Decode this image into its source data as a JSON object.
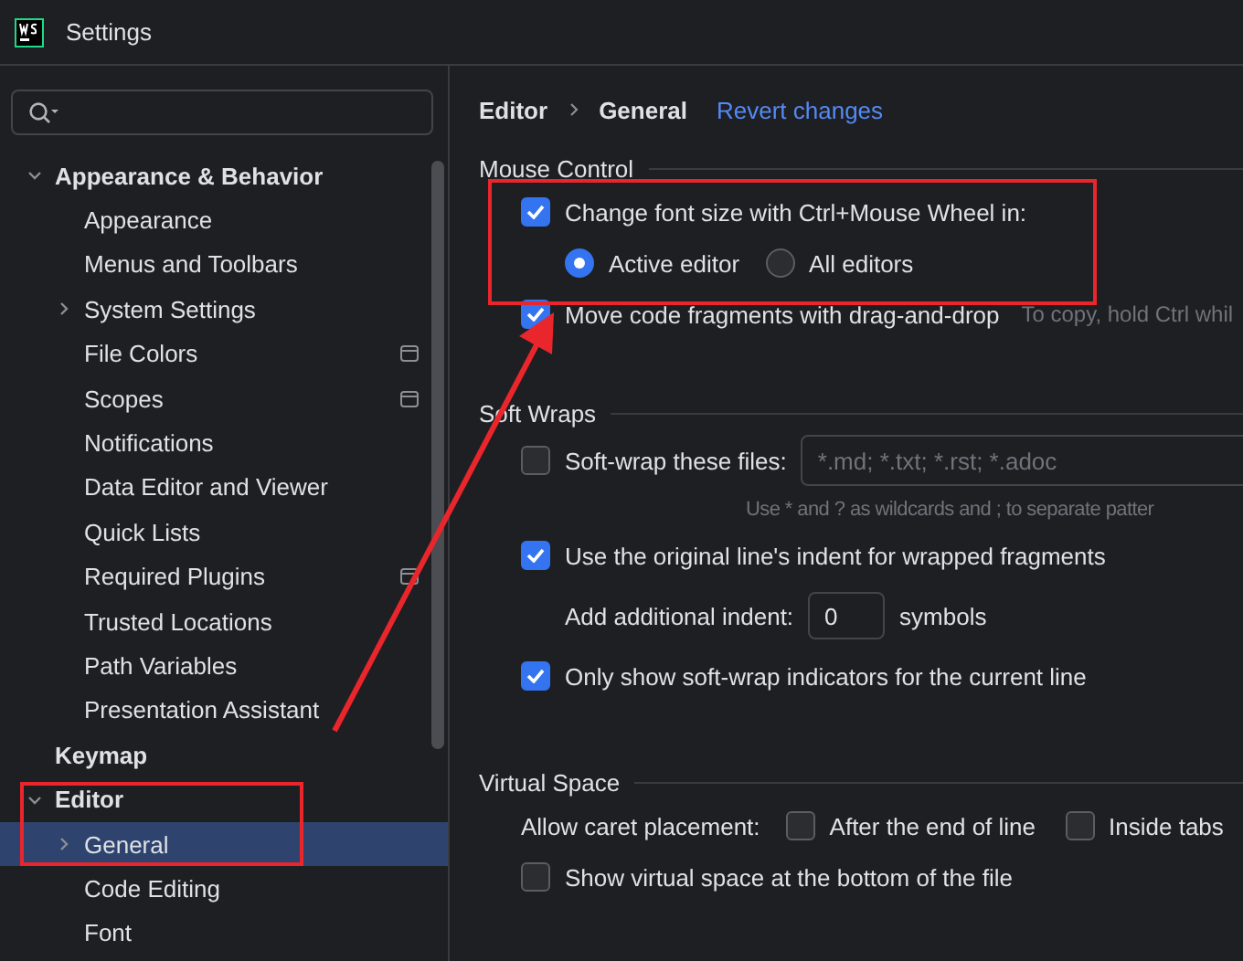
{
  "window": {
    "title": "Settings"
  },
  "sidebar": {
    "items": [
      {
        "label": "Appearance & Behavior",
        "expanded": true,
        "selected": false,
        "children": [
          {
            "label": "Appearance",
            "selected": false,
            "project_level": false
          },
          {
            "label": "Menus and Toolbars",
            "selected": false,
            "project_level": false
          },
          {
            "label": "System Settings",
            "expanded": false,
            "selected": false,
            "project_level": false
          },
          {
            "label": "File Colors",
            "selected": false,
            "project_level": true
          },
          {
            "label": "Scopes",
            "selected": false,
            "project_level": true
          },
          {
            "label": "Notifications",
            "selected": false,
            "project_level": false
          },
          {
            "label": "Data Editor and Viewer",
            "selected": false,
            "project_level": false
          },
          {
            "label": "Quick Lists",
            "selected": false,
            "project_level": false
          },
          {
            "label": "Required Plugins",
            "selected": false,
            "project_level": true
          },
          {
            "label": "Trusted Locations",
            "selected": false,
            "project_level": false
          },
          {
            "label": "Path Variables",
            "selected": false,
            "project_level": false
          },
          {
            "label": "Presentation Assistant",
            "selected": false,
            "project_level": false
          }
        ]
      },
      {
        "label": "Keymap",
        "selected": false
      },
      {
        "label": "Editor",
        "expanded": true,
        "selected": false,
        "children": [
          {
            "label": "General",
            "expanded": false,
            "selected": true,
            "project_level": false
          },
          {
            "label": "Code Editing",
            "selected": false,
            "project_level": false
          },
          {
            "label": "Font",
            "selected": false,
            "project_level": false
          }
        ]
      }
    ]
  },
  "breadcrumb": [
    "Editor",
    "General"
  ],
  "revert_link": "Revert changes",
  "sections": [
    {
      "title": "Mouse Control",
      "rows": [
        {
          "kind": "checkbox",
          "label": "Change font size with Ctrl+Mouse Wheel in:",
          "checked": true
        },
        {
          "kind": "radios",
          "options": [
            {
              "label": "Active editor",
              "selected": true
            },
            {
              "label": "All editors",
              "selected": false
            }
          ]
        },
        {
          "kind": "checkbox",
          "label": "Move code fragments with drag-and-drop",
          "checked": true,
          "hint": "To copy, hold Ctrl whil"
        }
      ]
    },
    {
      "title": "Soft Wraps",
      "rows": [
        {
          "kind": "checkbox_field",
          "label": "Soft-wrap these files:",
          "checked": false,
          "placeholder": "*.md; *.txt; *.rst; *.adoc"
        },
        {
          "kind": "note",
          "text": "Use * and ? as wildcards and ; to separate patter"
        },
        {
          "kind": "checkbox",
          "label": "Use the original line's indent for wrapped fragments",
          "checked": true
        },
        {
          "kind": "number",
          "label": "Add additional indent:",
          "value": "0",
          "unit": "symbols"
        },
        {
          "kind": "checkbox",
          "label": "Only show soft-wrap indicators for the current line",
          "checked": true
        }
      ]
    },
    {
      "title": "Virtual Space",
      "rows": [
        {
          "kind": "options",
          "label": "Allow caret placement:",
          "options": [
            {
              "label": "After the end of line",
              "checked": false
            },
            {
              "label": "Inside tabs",
              "checked": false
            }
          ]
        },
        {
          "kind": "checkbox",
          "label": "Show virtual space at the bottom of the file",
          "checked": false
        }
      ]
    }
  ]
}
